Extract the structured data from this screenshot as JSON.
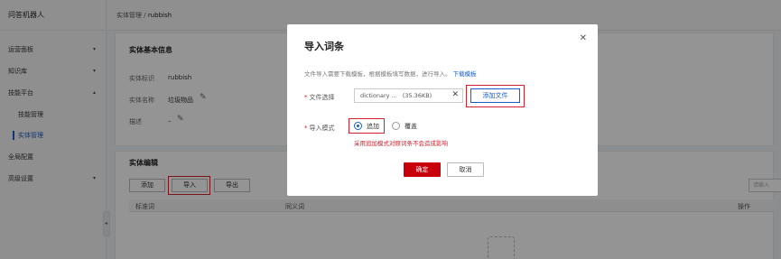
{
  "app": {
    "title": "问答机器人"
  },
  "sidebar": {
    "items": [
      {
        "label": "运营面板",
        "chevron": "▾"
      },
      {
        "label": "知识库",
        "chevron": "▾"
      },
      {
        "label": "技能平台",
        "chevron": "▴"
      },
      {
        "label": "技能管理"
      },
      {
        "label": "实体管理"
      },
      {
        "label": "全局配置"
      },
      {
        "label": "高级设置",
        "chevron": "▾"
      }
    ],
    "collapse_glyph": "◂"
  },
  "breadcrumb": {
    "parent": "实体管理",
    "separator": "/",
    "current": "rubbish"
  },
  "basic_info": {
    "title": "实体基本信息",
    "id_label": "实体标识",
    "id_value": "rubbish",
    "name_label": "实体名称",
    "name_value": "垃圾物品",
    "desc_label": "描述",
    "desc_value": "–",
    "edit_glyph": "✎"
  },
  "entity_edit": {
    "title": "实体编辑",
    "add_label": "添加",
    "import_label": "导入",
    "export_label": "导出",
    "search_placeholder": "请输入",
    "columns": [
      "标准词",
      "同义词",
      "操作"
    ]
  },
  "dialog": {
    "title": "导入词条",
    "close_glyph": "✕",
    "description": "文件导入需要下载模板，根据模板填写数据，进行导入。",
    "download_link": "下载模板",
    "required_mark": "*",
    "file_label": "文件选择",
    "file_name": "dictionary ...",
    "file_size": "(35.36KB)",
    "clear_glyph": "✕",
    "add_file_label": "添加文件",
    "mode_label": "导入模式",
    "mode_options": [
      "追加",
      "覆盖"
    ],
    "mode_selected": "追加",
    "mode_hint": "采用追加模式对原词条不会造成影响",
    "ok_label": "确定",
    "cancel_label": "取消"
  },
  "colors": {
    "accent": "#1a5cc8",
    "danger": "#d3212d",
    "primary_button": "#c7000b"
  }
}
